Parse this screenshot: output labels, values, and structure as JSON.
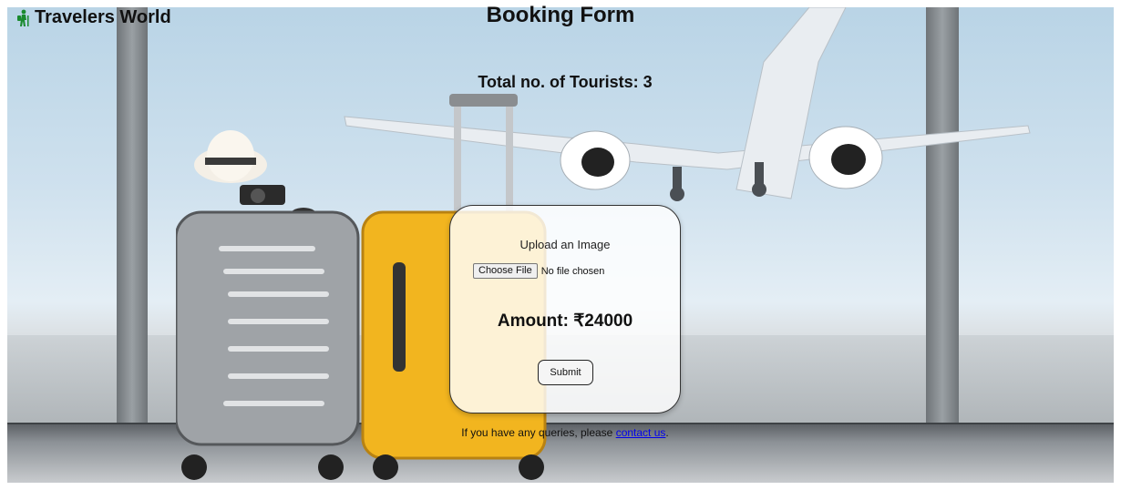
{
  "brand": {
    "name": "Travelers World",
    "icon": "hiker-icon",
    "icon_color": "#1a8a2e"
  },
  "page": {
    "title": "Booking Form"
  },
  "tourists": {
    "label": "Total no. of Tourists:",
    "count": "3"
  },
  "form": {
    "upload_label": "Upload an Image",
    "choose_file_label": "Choose File",
    "file_status": "No file chosen",
    "amount_label": "Amount:",
    "amount_value": "₹24000",
    "submit_label": "Submit"
  },
  "footer": {
    "prefix": "If you have any queries, please ",
    "link_text": "contact us",
    "suffix": "."
  },
  "colors": {
    "link": "#0000ee",
    "luggage_yellow": "#f2b51f",
    "luggage_silver": "#a7a9ab"
  }
}
